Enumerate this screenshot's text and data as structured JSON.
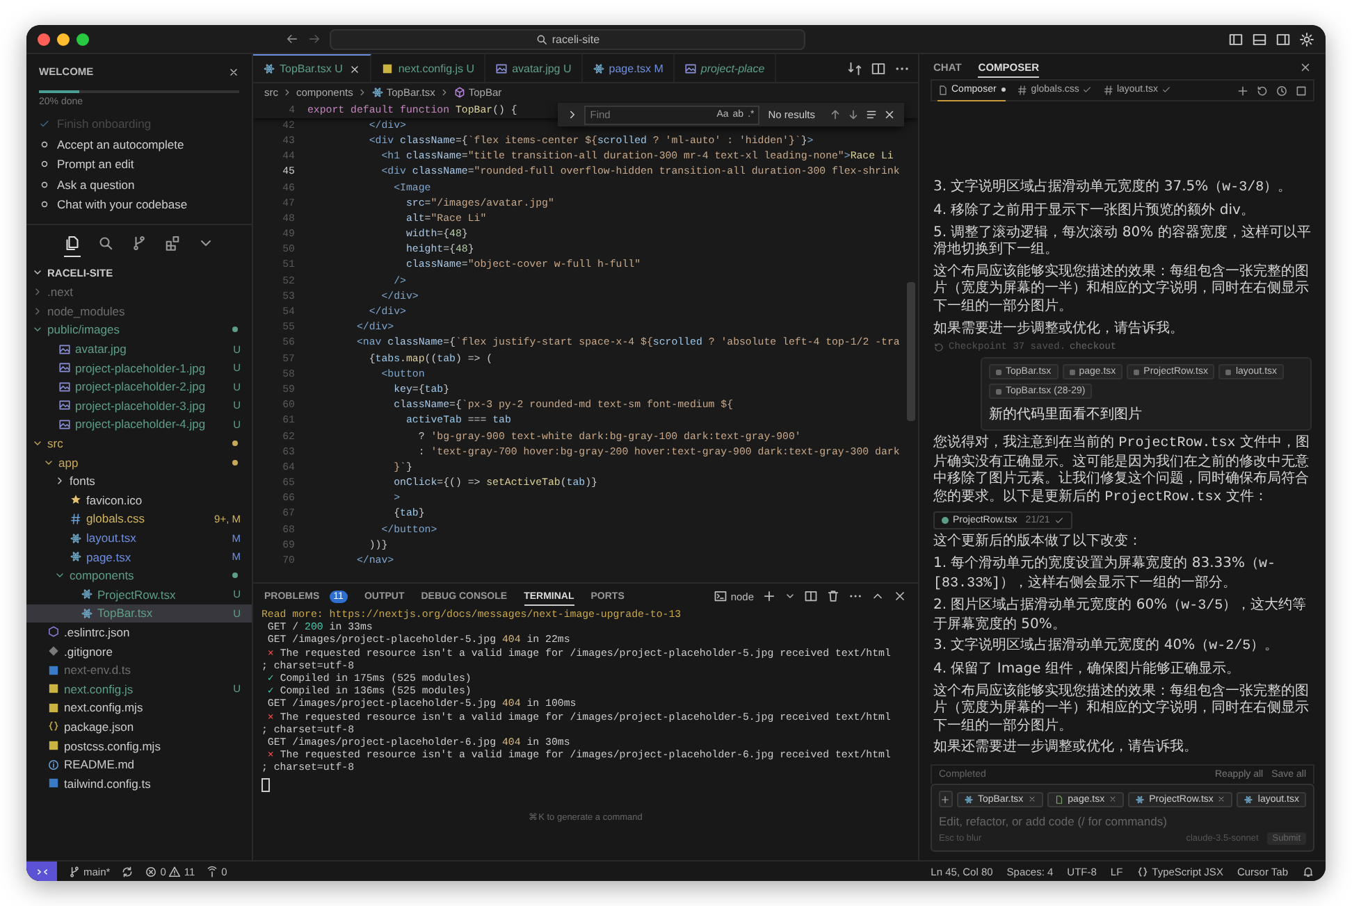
{
  "window": {
    "search": "raceli-site"
  },
  "sidebar": {
    "welcome": {
      "title": "WELCOME",
      "level": 0.2,
      "progress_label": "20% done",
      "steps": [
        {
          "label": "Finish onboarding",
          "done": true
        },
        {
          "label": "Accept an autocomplete",
          "done": false
        },
        {
          "label": "Prompt an edit",
          "done": false
        },
        {
          "label": "Ask a question",
          "done": false
        },
        {
          "label": "Chat with your codebase",
          "done": false
        }
      ]
    },
    "activity": [
      {
        "kind": "files",
        "selected": true
      },
      {
        "kind": "search",
        "selected": false
      },
      {
        "kind": "branch",
        "selected": false
      },
      {
        "kind": "extensions",
        "selected": false
      },
      {
        "kind": "chevron",
        "selected": false
      }
    ],
    "explorer": {
      "title": "RACELI-SITE",
      "tree": [
        {
          "name": ".next",
          "kind": "folder",
          "expanded": false,
          "modified": false,
          "color": "#6e6e6e",
          "selected": false
        },
        {
          "name": "node_modules",
          "kind": "folder",
          "expanded": false,
          "modified": false,
          "color": "#6e6e6e",
          "selected": false
        },
        {
          "name": "public/images",
          "kind": "folder",
          "expanded": true,
          "modified": true,
          "color": "#5d9e86",
          "selected": false,
          "children": [
            {
              "name": "avatar.jpg",
              "kind": "image",
              "badge": "U",
              "color": "#5d9e86",
              "selected": false
            },
            {
              "name": "project-placeholder-1.jpg",
              "kind": "image",
              "badge": "U",
              "color": "#5d9e86",
              "selected": false
            },
            {
              "name": "project-placeholder-2.jpg",
              "kind": "image",
              "badge": "U",
              "color": "#5d9e86",
              "selected": false
            },
            {
              "name": "project-placeholder-3.jpg",
              "kind": "image",
              "badge": "U",
              "color": "#5d9e86",
              "selected": false
            },
            {
              "name": "project-placeholder-4.jpg",
              "kind": "image",
              "badge": "U",
              "color": "#5d9e86",
              "selected": false
            }
          ]
        },
        {
          "name": "src",
          "kind": "folder",
          "expanded": true,
          "modified": true,
          "color": "#c8a95a",
          "selected": false,
          "children": [
            {
              "name": "app",
              "kind": "folder",
              "expanded": true,
              "modified": true,
              "color": "#c8a95a",
              "selected": false,
              "children": [
                {
                  "name": "fonts",
                  "kind": "folder",
                  "expanded": false,
                  "modified": false,
                  "color": "#cccccc",
                  "selected": false
                },
                {
                  "name": "favicon.ico",
                  "kind": "star",
                  "color": "#cccccc",
                  "selected": false
                },
                {
                  "name": "globals.css",
                  "kind": "css",
                  "badge": "9+, M",
                  "color": "#d2b45e",
                  "selected": false
                },
                {
                  "name": "layout.tsx",
                  "kind": "react",
                  "badge": "M",
                  "color": "#6f8fe0",
                  "selected": false
                },
                {
                  "name": "page.tsx",
                  "kind": "react",
                  "badge": "M",
                  "color": "#6f8fe0",
                  "selected": false
                },
                {
                  "name": "components",
                  "kind": "folder",
                  "expanded": true,
                  "modified": true,
                  "color": "#5d9e86",
                  "selected": false,
                  "children": [
                    {
                      "name": "ProjectRow.tsx",
                      "kind": "react",
                      "badge": "U",
                      "color": "#5d9e86",
                      "selected": false
                    },
                    {
                      "name": "TopBar.tsx",
                      "kind": "react",
                      "badge": "U",
                      "color": "#5d9e86",
                      "selected": true
                    }
                  ]
                }
              ]
            }
          ]
        },
        {
          "name": ".eslintrc.json",
          "kind": "eslint",
          "color": "#cccccc",
          "selected": false
        },
        {
          "name": ".gitignore",
          "kind": "git",
          "color": "#cccccc",
          "selected": false
        },
        {
          "name": "next-env.d.ts",
          "kind": "ts",
          "color": "#6e6e6e",
          "selected": false
        },
        {
          "name": "next.config.js",
          "kind": "js",
          "badge": "U",
          "color": "#5d9e86",
          "selected": false
        },
        {
          "name": "next.config.mjs",
          "kind": "js",
          "color": "#cccccc",
          "selected": false
        },
        {
          "name": "package.json",
          "kind": "json",
          "color": "#cccccc",
          "selected": false
        },
        {
          "name": "postcss.config.mjs",
          "kind": "js",
          "color": "#cccccc",
          "selected": false
        },
        {
          "name": "README.md",
          "kind": "info",
          "color": "#cccccc",
          "selected": false
        },
        {
          "name": "tailwind.config.ts",
          "kind": "ts",
          "color": "#cccccc",
          "selected": false
        }
      ]
    }
  },
  "editor": {
    "tabs": [
      {
        "label": "TopBar.tsx",
        "badge": "U",
        "kind": "react",
        "color": "#5d9e86",
        "selected": true,
        "preview": false
      },
      {
        "label": "next.config.js",
        "badge": "U",
        "kind": "js",
        "color": "#5d9e86",
        "selected": false,
        "preview": false
      },
      {
        "label": "avatar.jpg",
        "badge": "U",
        "kind": "image",
        "color": "#5d9e86",
        "selected": false,
        "preview": false
      },
      {
        "label": "page.tsx",
        "badge": "M",
        "kind": "react",
        "color": "#6f8fe0",
        "selected": false,
        "preview": false
      },
      {
        "label": "project-place",
        "kind": "image",
        "color": "#5d9e86",
        "selected": false,
        "preview": true
      }
    ],
    "breadcrumb": [
      {
        "label": "src",
        "kind": "folder"
      },
      {
        "label": "components",
        "kind": "folder"
      },
      {
        "label": "TopBar.tsx",
        "kind": "react"
      },
      {
        "label": "TopBar",
        "kind": "symbol"
      }
    ],
    "sticky_line": {
      "number": "4",
      "segments": [
        {
          "kind": "kw",
          "text": "export default function "
        },
        {
          "kind": "fn",
          "text": "TopBar"
        },
        {
          "kind": "pl",
          "text": "() {"
        }
      ]
    },
    "find": {
      "placeholder": "Find",
      "options": [
        "Aa",
        "ab",
        ".*"
      ],
      "result": "No results"
    },
    "lines": [
      {
        "number": "42",
        "current": false,
        "segments": [
          {
            "kind": "tag",
            "text": "          </div>"
          }
        ]
      },
      {
        "number": "43",
        "current": false,
        "segments": [
          {
            "kind": "tag",
            "text": "          <div"
          },
          {
            "kind": "attr",
            "text": " className"
          },
          {
            "kind": "pl",
            "text": "={"
          },
          {
            "kind": "str",
            "text": "`flex items-center ${"
          },
          {
            "kind": "var",
            "text": "scrolled"
          },
          {
            "kind": "str",
            "text": " ? 'ml-auto' : 'hidden'}`"
          },
          {
            "kind": "pl",
            "text": "}"
          },
          {
            "kind": "tag",
            "text": ">"
          }
        ]
      },
      {
        "number": "44",
        "current": false,
        "segments": [
          {
            "kind": "tag",
            "text": "            <h1"
          },
          {
            "kind": "attr",
            "text": " className"
          },
          {
            "kind": "pl",
            "text": "="
          },
          {
            "kind": "str",
            "text": "\"title transition-all duration-300 mr-4 text-xl leading-none\""
          },
          {
            "kind": "tag",
            "text": ">"
          },
          {
            "kind": "fn",
            "text": "Race Li"
          }
        ]
      },
      {
        "number": "45",
        "current": true,
        "segments": [
          {
            "kind": "tag",
            "text": "            <div"
          },
          {
            "kind": "attr",
            "text": " className"
          },
          {
            "kind": "pl",
            "text": "="
          },
          {
            "kind": "str",
            "text": "\"rounded-full overflow-hidden transition-all duration-300 flex-shrink"
          }
        ]
      },
      {
        "number": "46",
        "current": false,
        "segments": [
          {
            "kind": "tag",
            "text": "              <Image"
          }
        ]
      },
      {
        "number": "47",
        "current": false,
        "segments": [
          {
            "kind": "attr",
            "text": "                src"
          },
          {
            "kind": "pl",
            "text": "="
          },
          {
            "kind": "str",
            "text": "\"/images/avatar.jpg\""
          }
        ]
      },
      {
        "number": "48",
        "current": false,
        "segments": [
          {
            "kind": "attr",
            "text": "                alt"
          },
          {
            "kind": "pl",
            "text": "="
          },
          {
            "kind": "str",
            "text": "\"Race Li\""
          }
        ]
      },
      {
        "number": "49",
        "current": false,
        "segments": [
          {
            "kind": "attr",
            "text": "                width"
          },
          {
            "kind": "pl",
            "text": "={"
          },
          {
            "kind": "num",
            "text": "48"
          },
          {
            "kind": "pl",
            "text": "}"
          }
        ]
      },
      {
        "number": "50",
        "current": false,
        "segments": [
          {
            "kind": "attr",
            "text": "                height"
          },
          {
            "kind": "pl",
            "text": "={"
          },
          {
            "kind": "num",
            "text": "48"
          },
          {
            "kind": "pl",
            "text": "}"
          }
        ]
      },
      {
        "number": "51",
        "current": false,
        "segments": [
          {
            "kind": "attr",
            "text": "                className"
          },
          {
            "kind": "pl",
            "text": "="
          },
          {
            "kind": "str",
            "text": "\"object-cover w-full h-full\""
          }
        ]
      },
      {
        "number": "52",
        "current": false,
        "segments": [
          {
            "kind": "tag",
            "text": "              />"
          }
        ]
      },
      {
        "number": "53",
        "current": false,
        "segments": [
          {
            "kind": "tag",
            "text": "            </div>"
          }
        ]
      },
      {
        "number": "54",
        "current": false,
        "segments": [
          {
            "kind": "tag",
            "text": "          </div>"
          }
        ]
      },
      {
        "number": "55",
        "current": false,
        "segments": [
          {
            "kind": "tag",
            "text": "        </div>"
          }
        ]
      },
      {
        "number": "56",
        "current": false,
        "segments": [
          {
            "kind": "tag",
            "text": "        <nav"
          },
          {
            "kind": "attr",
            "text": " className"
          },
          {
            "kind": "pl",
            "text": "={"
          },
          {
            "kind": "str",
            "text": "`flex justify-start space-x-4 ${"
          },
          {
            "kind": "var",
            "text": "scrolled"
          },
          {
            "kind": "str",
            "text": " ? 'absolute left-4 top-1/2 -tra"
          }
        ]
      },
      {
        "number": "57",
        "current": false,
        "segments": [
          {
            "kind": "pl",
            "text": "          {"
          },
          {
            "kind": "var",
            "text": "tabs"
          },
          {
            "kind": "pl",
            "text": "."
          },
          {
            "kind": "fn",
            "text": "map"
          },
          {
            "kind": "pl",
            "text": "(("
          },
          {
            "kind": "var",
            "text": "tab"
          },
          {
            "kind": "pl",
            "text": ") => ("
          }
        ]
      },
      {
        "number": "58",
        "current": false,
        "segments": [
          {
            "kind": "tag",
            "text": "            <button"
          }
        ]
      },
      {
        "number": "59",
        "current": false,
        "segments": [
          {
            "kind": "attr",
            "text": "              key"
          },
          {
            "kind": "pl",
            "text": "={"
          },
          {
            "kind": "var",
            "text": "tab"
          },
          {
            "kind": "pl",
            "text": "}"
          }
        ]
      },
      {
        "number": "60",
        "current": false,
        "segments": [
          {
            "kind": "attr",
            "text": "              className"
          },
          {
            "kind": "pl",
            "text": "={"
          },
          {
            "kind": "str",
            "text": "`px-3 py-2 rounded-md text-sm font-medium ${"
          }
        ]
      },
      {
        "number": "61",
        "current": false,
        "segments": [
          {
            "kind": "var",
            "text": "                activeTab"
          },
          {
            "kind": "pl",
            "text": " === "
          },
          {
            "kind": "var",
            "text": "tab"
          }
        ]
      },
      {
        "number": "62",
        "current": false,
        "segments": [
          {
            "kind": "pl",
            "text": "                  ? "
          },
          {
            "kind": "str",
            "text": "'bg-gray-900 text-white dark:bg-gray-100 dark:text-gray-900'"
          }
        ]
      },
      {
        "number": "63",
        "current": false,
        "segments": [
          {
            "kind": "pl",
            "text": "                  : "
          },
          {
            "kind": "str",
            "text": "'text-gray-700 hover:bg-gray-200 hover:text-gray-900 dark:text-gray-300 dark"
          }
        ]
      },
      {
        "number": "64",
        "current": false,
        "segments": [
          {
            "kind": "str",
            "text": "              }`"
          },
          {
            "kind": "pl",
            "text": "}"
          }
        ]
      },
      {
        "number": "65",
        "current": false,
        "segments": [
          {
            "kind": "attr",
            "text": "              onClick"
          },
          {
            "kind": "pl",
            "text": "={() => "
          },
          {
            "kind": "fn",
            "text": "setActiveTab"
          },
          {
            "kind": "pl",
            "text": "("
          },
          {
            "kind": "var",
            "text": "tab"
          },
          {
            "kind": "pl",
            "text": ")}"
          }
        ]
      },
      {
        "number": "66",
        "current": false,
        "segments": [
          {
            "kind": "tag",
            "text": "              >"
          }
        ]
      },
      {
        "number": "67",
        "current": false,
        "segments": [
          {
            "kind": "pl",
            "text": "              {"
          },
          {
            "kind": "var",
            "text": "tab"
          },
          {
            "kind": "pl",
            "text": "}"
          }
        ]
      },
      {
        "number": "68",
        "current": false,
        "segments": [
          {
            "kind": "tag",
            "text": "            </button>"
          }
        ]
      },
      {
        "number": "69",
        "current": false,
        "segments": [
          {
            "kind": "pl",
            "text": "          ))}"
          }
        ]
      },
      {
        "number": "70",
        "current": false,
        "segments": [
          {
            "kind": "tag",
            "text": "        </nav>"
          }
        ]
      }
    ]
  },
  "panel": {
    "tabs": [
      {
        "label": "PROBLEMS",
        "count": "11",
        "selected": false
      },
      {
        "label": "OUTPUT",
        "selected": false
      },
      {
        "label": "DEBUG CONSOLE",
        "selected": false
      },
      {
        "label": "TERMINAL",
        "selected": true
      },
      {
        "label": "PORTS",
        "selected": false
      }
    ],
    "shell": "node",
    "lines": [
      {
        "segments": [
          {
            "kind": "info",
            "text": "Read more: https://nextjs.org/docs/messages/next-image-upgrade-to-13"
          }
        ]
      },
      {
        "segments": [
          {
            "kind": "pl",
            "text": " GET / "
          },
          {
            "kind": "ok",
            "text": "200"
          },
          {
            "kind": "pl",
            "text": " in 33ms"
          }
        ]
      },
      {
        "segments": [
          {
            "kind": "pl",
            "text": " GET /images/project-placeholder-5.jpg "
          },
          {
            "kind": "warn",
            "text": "404"
          },
          {
            "kind": "pl",
            "text": " in 22ms"
          }
        ]
      },
      {
        "segments": [
          {
            "kind": "err",
            "text": " ⨯"
          },
          {
            "kind": "pl",
            "text": " The requested resource isn't a valid image for /images/project-placeholder-5.jpg received text/html"
          }
        ]
      },
      {
        "segments": [
          {
            "kind": "pl",
            "text": "; charset=utf-8"
          }
        ]
      },
      {
        "segments": [
          {
            "kind": "ok",
            "text": " ✓"
          },
          {
            "kind": "pl",
            "text": " Compiled in 175ms (525 modules)"
          }
        ]
      },
      {
        "segments": [
          {
            "kind": "ok",
            "text": " ✓"
          },
          {
            "kind": "pl",
            "text": " Compiled in 136ms (525 modules)"
          }
        ]
      },
      {
        "segments": [
          {
            "kind": "pl",
            "text": " GET /images/project-placeholder-5.jpg "
          },
          {
            "kind": "warn",
            "text": "404"
          },
          {
            "kind": "pl",
            "text": " in 100ms"
          }
        ]
      },
      {
        "segments": [
          {
            "kind": "err",
            "text": " ⨯"
          },
          {
            "kind": "pl",
            "text": " The requested resource isn't a valid image for /images/project-placeholder-5.jpg received text/html"
          }
        ]
      },
      {
        "segments": [
          {
            "kind": "pl",
            "text": "; charset=utf-8"
          }
        ]
      },
      {
        "segments": [
          {
            "kind": "pl",
            "text": " GET /images/project-placeholder-6.jpg "
          },
          {
            "kind": "warn",
            "text": "404"
          },
          {
            "kind": "pl",
            "text": " in 30ms"
          }
        ]
      },
      {
        "segments": [
          {
            "kind": "err",
            "text": " ⨯"
          },
          {
            "kind": "pl",
            "text": " The requested resource isn't a valid image for /images/project-placeholder-6.jpg received text/html"
          }
        ]
      },
      {
        "segments": [
          {
            "kind": "pl",
            "text": "; charset=utf-8"
          }
        ]
      }
    ],
    "hint": "⌘K to generate a command"
  },
  "composer": {
    "tabs": [
      {
        "label": "CHAT",
        "selected": false
      },
      {
        "label": "COMPOSER",
        "selected": true
      }
    ],
    "files": [
      {
        "label": "Composer",
        "kind": "dirty",
        "selected": true
      },
      {
        "label": "globals.css",
        "kind": "applied",
        "selected": false
      },
      {
        "label": "layout.tsx",
        "kind": "applied",
        "selected": false
      }
    ],
    "messages": [
      {
        "kind": "text",
        "segments": [
          {
            "kind": "text",
            "text": "3. 文字说明区域占据滑动单元宽度的 37.5%（"
          },
          {
            "kind": "code",
            "text": "w-3/8"
          },
          {
            "kind": "text",
            "text": "）。"
          }
        ]
      },
      {
        "kind": "text",
        "segments": [
          {
            "kind": "text",
            "text": "4. 移除了之前用于显示下一张图片预览的额外 div。"
          }
        ]
      },
      {
        "kind": "text",
        "segments": [
          {
            "kind": "text",
            "text": "5. 调整了滚动逻辑，每次滚动 80% 的容器宽度，这样可以平滑地切换到下一组。"
          }
        ]
      },
      {
        "kind": "text",
        "segments": [
          {
            "kind": "text",
            "text": "这个布局应该能够实现您描述的效果：每组包含一张完整的图片（宽度为屏幕的一半）和相应的文字说明，同时在右侧显示下一组的一部分图片。"
          }
        ]
      },
      {
        "kind": "text",
        "segments": [
          {
            "kind": "text",
            "text": "如果需要进一步调整或优化，请告诉我。"
          }
        ]
      },
      {
        "kind": "checkpoint",
        "text": "Checkpoint 37 saved.",
        "link": "checkout"
      },
      {
        "kind": "user",
        "chips": [
          "TopBar.tsx",
          "page.tsx",
          "ProjectRow.tsx",
          "layout.tsx",
          "TopBar.tsx (28-29)"
        ],
        "text": "新的代码里面看不到图片"
      },
      {
        "kind": "text",
        "segments": [
          {
            "kind": "text",
            "text": "您说得对，我注意到在当前的 "
          },
          {
            "kind": "code",
            "text": "ProjectRow.tsx"
          },
          {
            "kind": "text",
            "text": " 文件中，图片确实没有正确显示。这可能是因为我们在之前的修改中无意中移除了图片元素。让我们修复这个问题，同时确保布局符合您的要求。以下是更新后的 "
          },
          {
            "kind": "code",
            "text": "ProjectRow.tsx"
          },
          {
            "kind": "text",
            "text": " 文件："
          }
        ]
      },
      {
        "kind": "file",
        "label": "ProjectRow.tsx",
        "status": "21/21"
      },
      {
        "kind": "text",
        "segments": [
          {
            "kind": "text",
            "text": "这个更新后的版本做了以下改变："
          }
        ]
      },
      {
        "kind": "text",
        "segments": [
          {
            "kind": "text",
            "text": "1. 每个滑动单元的宽度设置为屏幕宽度的 83.33%（"
          },
          {
            "kind": "code",
            "text": "w-[83.33%]"
          },
          {
            "kind": "text",
            "text": "），这样右侧会显示下一组的一部分。"
          }
        ]
      },
      {
        "kind": "text",
        "segments": [
          {
            "kind": "text",
            "text": "2. 图片区域占据滑动单元宽度的 60%（"
          },
          {
            "kind": "code",
            "text": "w-3/5"
          },
          {
            "kind": "text",
            "text": "），这大约等于屏幕宽度的 50%。"
          }
        ]
      },
      {
        "kind": "text",
        "segments": [
          {
            "kind": "text",
            "text": "3. 文字说明区域占据滑动单元宽度的 40%（"
          },
          {
            "kind": "code",
            "text": "w-2/5"
          },
          {
            "kind": "text",
            "text": "）。"
          }
        ]
      },
      {
        "kind": "text",
        "segments": [
          {
            "kind": "text",
            "text": "4. 保留了 Image 组件，确保图片能够正确显示。"
          }
        ]
      },
      {
        "kind": "text",
        "segments": [
          {
            "kind": "text",
            "text": "这个布局应该能够实现您描述的效果：每组包含一张完整的图片（宽度为屏幕的一半）和相应的文字说明，同时在右侧显示下一组的一部分图片。"
          }
        ]
      },
      {
        "kind": "text",
        "segments": [
          {
            "kind": "text",
            "text": "如果还需要进一步调整或优化，请告诉我。"
          }
        ]
      }
    ],
    "completed": {
      "label": "Completed",
      "actions": [
        "Reapply all",
        "Save all"
      ]
    },
    "context_chips": [
      {
        "label": "TopBar.tsx",
        "kind": "react",
        "closable": true
      },
      {
        "label": "page.tsx",
        "kind": "page",
        "closable": true
      },
      {
        "label": "ProjectRow.tsx",
        "kind": "react",
        "closable": true
      },
      {
        "label": "layout.tsx",
        "kind": "react",
        "closable": false
      }
    ],
    "placeholder": "Edit, refactor, or add code (/ for commands)",
    "footer": {
      "hint": "Esc to blur",
      "model": "claude-3.5-sonnet",
      "submit": "Submit"
    }
  },
  "status_bar": {
    "branch": "main*",
    "errors": "0",
    "warnings": "11",
    "ports": "0",
    "items": [
      {
        "label": "Ln 45, Col 80",
        "kind": "text"
      },
      {
        "label": "Spaces: 4",
        "kind": "text"
      },
      {
        "label": "UTF-8",
        "kind": "text"
      },
      {
        "label": "LF",
        "kind": "text"
      },
      {
        "label": "TypeScript JSX",
        "kind": "language"
      },
      {
        "label": "Cursor Tab",
        "kind": "text"
      }
    ]
  }
}
